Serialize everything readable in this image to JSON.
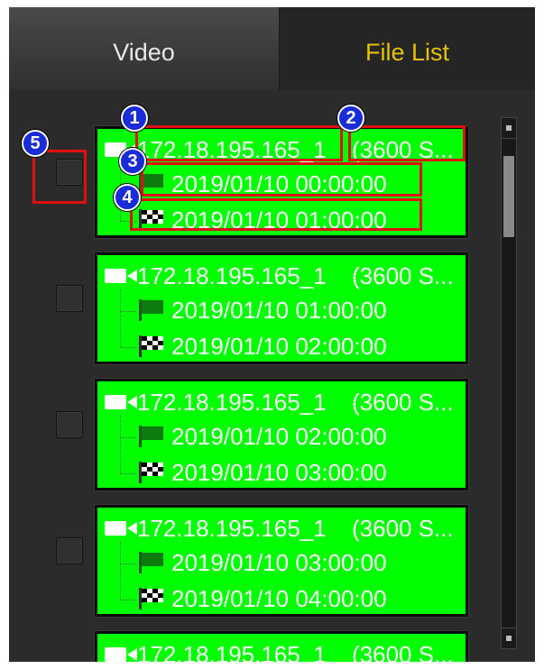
{
  "tabs": [
    {
      "label": "Video",
      "active": false
    },
    {
      "label": "File List",
      "active": true
    }
  ],
  "colors": {
    "active_tab_text": "#e6c200",
    "card_background": "#00ff00",
    "annotation_box": "#e01010",
    "annotation_badge": "#1a2bd8"
  },
  "recordings": [
    {
      "ip": "172.18.195.165_1",
      "duration": "(3600 S...",
      "start": "2019/01/10 00:00:00",
      "end": "2019/01/10 01:00:00",
      "checked": false
    },
    {
      "ip": "172.18.195.165_1",
      "duration": "(3600 S...",
      "start": "2019/01/10 01:00:00",
      "end": "2019/01/10 02:00:00",
      "checked": false
    },
    {
      "ip": "172.18.195.165_1",
      "duration": "(3600 S...",
      "start": "2019/01/10 02:00:00",
      "end": "2019/01/10 03:00:00",
      "checked": false
    },
    {
      "ip": "172.18.195.165_1",
      "duration": "(3600 S...",
      "start": "2019/01/10 03:00:00",
      "end": "2019/01/10 04:00:00",
      "checked": false
    },
    {
      "ip": "172.18.195.165_1",
      "duration": "(3600 S...",
      "checked": false
    }
  ],
  "annotations": [
    {
      "number": "1",
      "target": "recording-ip"
    },
    {
      "number": "2",
      "target": "recording-duration"
    },
    {
      "number": "3",
      "target": "start-time"
    },
    {
      "number": "4",
      "target": "end-time"
    },
    {
      "number": "5",
      "target": "select-checkbox"
    }
  ],
  "icons": {
    "camera": "video-camera-icon",
    "start": "green-flag-icon",
    "end": "checkered-flag-icon"
  }
}
